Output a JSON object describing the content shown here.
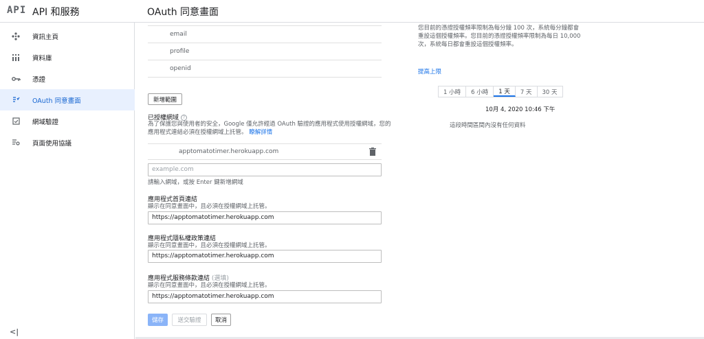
{
  "header": {
    "logo": "API",
    "app_title": "API 和服務",
    "page_title": "OAuth 同意畫面"
  },
  "sidebar": {
    "items": [
      {
        "label": "資訊主頁",
        "icon": "dashboard-icon"
      },
      {
        "label": "資料庫",
        "icon": "library-icon"
      },
      {
        "label": "憑證",
        "icon": "key-icon"
      },
      {
        "label": "OAuth 同意畫面",
        "icon": "consent-icon",
        "active": true
      },
      {
        "label": "網域驗證",
        "icon": "domain-verify-icon"
      },
      {
        "label": "頁面使用協議",
        "icon": "settings-icon"
      }
    ],
    "collapse_label": "<|"
  },
  "scopes": {
    "items": [
      "email",
      "profile",
      "openid"
    ],
    "add_button": "新增範圍"
  },
  "authorized_domains": {
    "title": "已授權網域",
    "help": "?",
    "description": "為了保護您與使用者的安全，Google 僅允許經過 OAuth 驗證的應用程式使用授權網域，您的應用程式連結必須在授權網域上託管。",
    "learn_more": "瞭解詳情",
    "domain": "apptomatotimer.herokuapp.com",
    "input_placeholder": "example.com",
    "input_hint": "請輸入網域，或按 Enter 鍵新增網域"
  },
  "homepage": {
    "title": "應用程式首頁連結",
    "hint": "顯示在同意畫面中，且必須在授權網域上託管。",
    "value": "https://apptomatotimer.herokuapp.com"
  },
  "privacy": {
    "title": "應用程式隱私權政策連結",
    "hint": "顯示在同意畫面中，且必須在授權網域上託管。",
    "value": "https://apptomatotimer.herokuapp.com"
  },
  "tos": {
    "title": "應用程式服務條款連結",
    "optional": "(選填)",
    "hint": "顯示在同意畫面中，且必須在授權網域上託管。",
    "value": "https://apptomatotimer.herokuapp.com"
  },
  "actions": {
    "save": "儲存",
    "submit": "送交驗證",
    "cancel": "取消"
  },
  "quota": {
    "info": "您目前的憑證授權頻率限制為每分鐘 100 次，系統每分鐘都會重設這個授權頻率。您目前的憑證授權頻率限制為每日 10,000 次，系統每日都會重設這個授權頻率。",
    "raise_link": "提高上限",
    "tabs": [
      "1 小時",
      "6 小時",
      "1 天",
      "7 天",
      "30 天"
    ],
    "active_tab": "1 天",
    "date": "10月 4, 2020 10:46 下午",
    "no_data": "這段時間區間內沒有任何資料"
  }
}
